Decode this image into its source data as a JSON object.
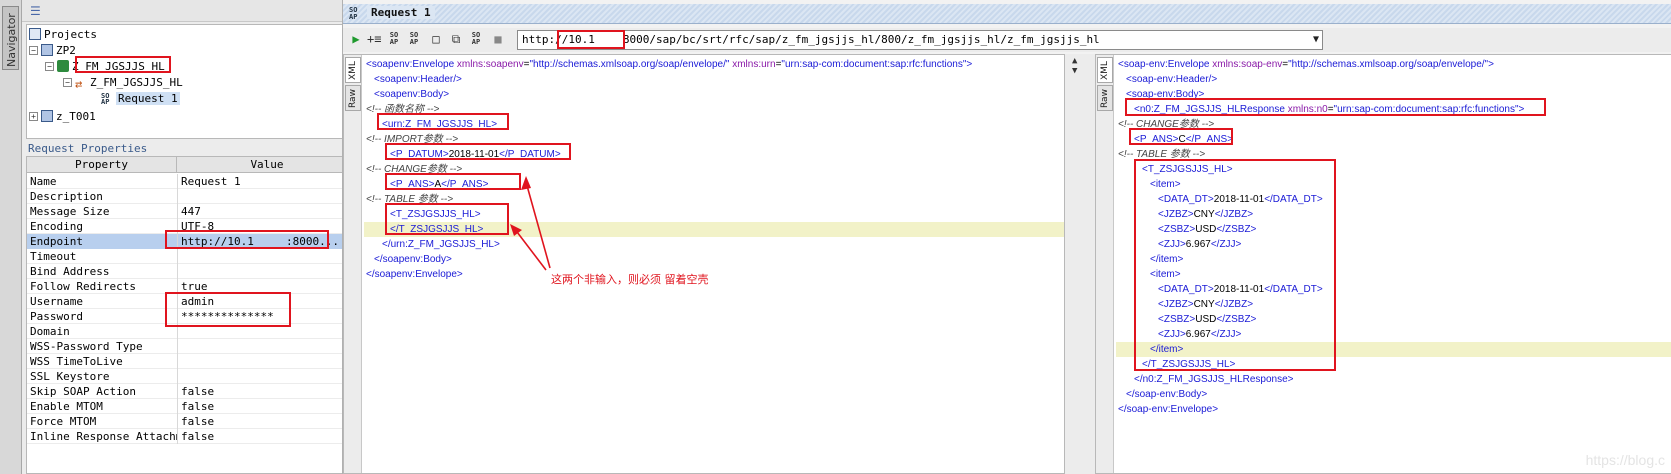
{
  "navigator": {
    "tab_label": "Navigator"
  },
  "tree": {
    "nodes": [
      {
        "label": "Projects",
        "icon": "project-icon"
      },
      {
        "label": "ZP2",
        "icon": "folder-icon"
      },
      {
        "label": "Z_FM_JGSJJS_HL",
        "icon": "binding-icon"
      },
      {
        "label": "Z_FM_JGSJJS_HL",
        "icon": "operation-icon"
      },
      {
        "label": "Request 1",
        "icon": "soap-request-icon"
      },
      {
        "label": "z_T001",
        "icon": "folder-icon"
      }
    ]
  },
  "properties": {
    "title": "Request Properties",
    "columns": [
      "Property",
      "Value"
    ],
    "rows": [
      {
        "name": "Name",
        "value": "Request 1"
      },
      {
        "name": "Description",
        "value": ""
      },
      {
        "name": "Message Size",
        "value": "447"
      },
      {
        "name": "Encoding",
        "value": "UTF-8"
      },
      {
        "name": "Endpoint",
        "value": "http://10.1"
      },
      {
        "name": "Timeout",
        "value": ""
      },
      {
        "name": "Bind Address",
        "value": ""
      },
      {
        "name": "Follow Redirects",
        "value": "true"
      },
      {
        "name": "Username",
        "value": "admin"
      },
      {
        "name": "Password",
        "value": "**************"
      },
      {
        "name": "Domain",
        "value": ""
      },
      {
        "name": "WSS-Password Type",
        "value": ""
      },
      {
        "name": "WSS TimeToLive",
        "value": ""
      },
      {
        "name": "SSL Keystore",
        "value": ""
      },
      {
        "name": "Skip SOAP Action",
        "value": "false"
      },
      {
        "name": "Enable MTOM",
        "value": "false"
      },
      {
        "name": "Force MTOM",
        "value": "false"
      },
      {
        "name": "Inline Response Attachm...",
        "value": "false"
      }
    ],
    "endpoint_suffix": ":8000..."
  },
  "request": {
    "title": "Request 1",
    "endpoint_prefix": "http://",
    "endpoint_host": "10.1",
    "endpoint_path": "8000/sap/bc/srt/rfc/sap/z_fm_jgsjjs_hl/800/z_fm_jgsjjs_hl/z_fm_jgsjjs_hl",
    "side_tabs": [
      "XML",
      "Raw"
    ]
  },
  "request_xml": [
    {
      "indent": 0,
      "parts": [
        [
          "t",
          "<soapenv:Envelope "
        ],
        [
          "a",
          "xmlns:soapenv"
        ],
        [
          "txt",
          "="
        ],
        [
          "v",
          "\"http://schemas.xmlsoap.org/soap/envelope/\" "
        ],
        [
          "a",
          "xmlns:urn"
        ],
        [
          "txt",
          "="
        ],
        [
          "v",
          "\"urn:sap-com:document:sap:rfc:functions\">"
        ]
      ]
    },
    {
      "indent": 1,
      "parts": [
        [
          "t",
          "<soapenv:Header/>"
        ]
      ]
    },
    {
      "indent": 1,
      "parts": [
        [
          "t",
          "<soapenv:Body>"
        ]
      ]
    },
    {
      "indent": 0,
      "parts": [
        [
          "c",
          "<!-- 函数名称 -->"
        ]
      ]
    },
    {
      "indent": 2,
      "parts": [
        [
          "t",
          "<urn:Z_FM_JGSJJS_HL>"
        ]
      ]
    },
    {
      "indent": 0,
      "parts": [
        [
          "c",
          "<!-- IMPORT参数 -->"
        ]
      ]
    },
    {
      "indent": 3,
      "parts": [
        [
          "t",
          "<P_DATUM>"
        ],
        [
          "txt",
          "2018-11-01"
        ],
        [
          "t",
          "</P_DATUM>"
        ]
      ]
    },
    {
      "indent": 0,
      "parts": [
        [
          "c",
          "<!-- CHANGE参数 -->"
        ]
      ]
    },
    {
      "indent": 3,
      "parts": [
        [
          "t",
          "<P_ANS>"
        ],
        [
          "txt",
          "A"
        ],
        [
          "t",
          "</P_ANS>"
        ]
      ]
    },
    {
      "indent": 0,
      "parts": [
        [
          "c",
          "<!-- TABLE 参数 -->"
        ]
      ]
    },
    {
      "indent": 3,
      "parts": [
        [
          "t",
          "<T_ZSJGSJJS_HL>"
        ]
      ]
    },
    {
      "indent": 3,
      "parts": [
        [
          "t",
          "</T_ZSJGSJJS_HL>"
        ]
      ],
      "highlight": true
    },
    {
      "indent": 2,
      "parts": [
        [
          "t",
          "</urn:Z_FM_JGSJJS_HL>"
        ]
      ]
    },
    {
      "indent": 1,
      "parts": [
        [
          "t",
          "</soapenv:Body>"
        ]
      ]
    },
    {
      "indent": 0,
      "parts": [
        [
          "t",
          "</soapenv:Envelope>"
        ]
      ]
    }
  ],
  "response_xml": [
    {
      "indent": 0,
      "parts": [
        [
          "t",
          "<soap-env:Envelope "
        ],
        [
          "a",
          "xmlns:soap-env"
        ],
        [
          "txt",
          "="
        ],
        [
          "v",
          "\"http://schemas.xmlsoap.org/soap/envelope/\">"
        ]
      ]
    },
    {
      "indent": 1,
      "parts": [
        [
          "t",
          "<soap-env:Header/>"
        ]
      ]
    },
    {
      "indent": 1,
      "parts": [
        [
          "t",
          "<soap-env:Body>"
        ]
      ]
    },
    {
      "indent": 2,
      "parts": [
        [
          "t",
          "<n0:Z_FM_JGSJJS_HLResponse "
        ],
        [
          "a",
          "xmlns:n0"
        ],
        [
          "txt",
          "="
        ],
        [
          "v",
          "\"urn:sap-com:document:sap:rfc:functions\">"
        ]
      ]
    },
    {
      "indent": 0,
      "parts": [
        [
          "c",
          "<!-- CHANGE参数 -->"
        ]
      ]
    },
    {
      "indent": 2,
      "parts": [
        [
          "t",
          "<P_ANS>"
        ],
        [
          "txt",
          "C"
        ],
        [
          "t",
          "</P_ANS>"
        ]
      ]
    },
    {
      "indent": 0,
      "parts": [
        [
          "c",
          "<!-- TABLE 参数 -->"
        ]
      ]
    },
    {
      "indent": 3,
      "parts": [
        [
          "t",
          "<T_ZSJGSJJS_HL>"
        ]
      ]
    },
    {
      "indent": 4,
      "parts": [
        [
          "t",
          "<item>"
        ]
      ]
    },
    {
      "indent": 5,
      "parts": [
        [
          "t",
          "<DATA_DT>"
        ],
        [
          "txt",
          "2018-11-01"
        ],
        [
          "t",
          "</DATA_DT>"
        ]
      ]
    },
    {
      "indent": 5,
      "parts": [
        [
          "t",
          "<JZBZ>"
        ],
        [
          "txt",
          "CNY"
        ],
        [
          "t",
          "</JZBZ>"
        ]
      ]
    },
    {
      "indent": 5,
      "parts": [
        [
          "t",
          "<ZSBZ>"
        ],
        [
          "txt",
          "USD"
        ],
        [
          "t",
          "</ZSBZ>"
        ]
      ]
    },
    {
      "indent": 5,
      "parts": [
        [
          "t",
          "<ZJJ>"
        ],
        [
          "txt",
          "6.967"
        ],
        [
          "t",
          "</ZJJ>"
        ]
      ]
    },
    {
      "indent": 4,
      "parts": [
        [
          "t",
          "</item>"
        ]
      ]
    },
    {
      "indent": 4,
      "parts": [
        [
          "t",
          "<item>"
        ]
      ]
    },
    {
      "indent": 5,
      "parts": [
        [
          "t",
          "<DATA_DT>"
        ],
        [
          "txt",
          "2018-11-01"
        ],
        [
          "t",
          "</DATA_DT>"
        ]
      ]
    },
    {
      "indent": 5,
      "parts": [
        [
          "t",
          "<JZBZ>"
        ],
        [
          "txt",
          "CNY"
        ],
        [
          "t",
          "</JZBZ>"
        ]
      ]
    },
    {
      "indent": 5,
      "parts": [
        [
          "t",
          "<ZSBZ>"
        ],
        [
          "txt",
          "USD"
        ],
        [
          "t",
          "</ZSBZ>"
        ]
      ]
    },
    {
      "indent": 5,
      "parts": [
        [
          "t",
          "<ZJJ>"
        ],
        [
          "txt",
          "6.967"
        ],
        [
          "t",
          "</ZJJ>"
        ]
      ]
    },
    {
      "indent": 4,
      "parts": [
        [
          "t",
          "</item>"
        ]
      ],
      "highlight": true
    },
    {
      "indent": 3,
      "parts": [
        [
          "t",
          "</T_ZSJGSJJS_HL>"
        ]
      ]
    },
    {
      "indent": 2,
      "parts": [
        [
          "t",
          "</n0:Z_FM_JGSJJS_HLResponse>"
        ]
      ]
    },
    {
      "indent": 1,
      "parts": [
        [
          "t",
          "</soap-env:Body>"
        ]
      ]
    },
    {
      "indent": 0,
      "parts": [
        [
          "t",
          "</soap-env:Envelope>"
        ]
      ]
    }
  ],
  "annotation": "这两个非输入，则必须 留着空壳",
  "watermark": "https://blog.c",
  "colors": {
    "annotation_red": "#e0141e",
    "xml_tag": "#1a1ad6",
    "xml_attr": "#8a1aa8",
    "line_highlight": "#f2f2c8"
  }
}
